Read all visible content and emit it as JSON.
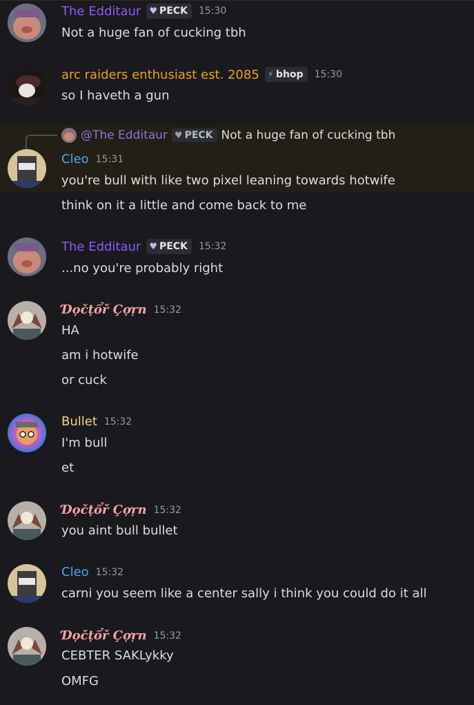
{
  "colors": {
    "edditaur": "#8a5cf5",
    "arc": "#f0a020",
    "cleo": "#4fa3f5",
    "bullet": "#f5d37a",
    "corn": "#f5a3a3"
  },
  "messages": [
    {
      "username": "The Edditaur",
      "tag": "PECK",
      "tag_icon": "heart-icon",
      "time": "15:30",
      "lines": [
        "Not a huge fan of cucking tbh"
      ]
    },
    {
      "username": "arc raiders enthusiast est. 2085",
      "tag": "bhop",
      "tag_icon": "lightning-icon",
      "time": "15:30",
      "lines": [
        "so I haveth a gun"
      ]
    },
    {
      "reply": {
        "username": "@The Edditaur",
        "tag": "PECK",
        "text": "Not a huge fan of cucking tbh"
      },
      "username": "Cleo",
      "time": "15:31",
      "lines": [
        "you're bull with like two pixel leaning towards hotwife",
        "think on it a little and come back to me"
      ]
    },
    {
      "username": "The Edditaur",
      "tag": "PECK",
      "tag_icon": "heart-icon",
      "time": "15:32",
      "lines": [
        "...no you're probably right"
      ]
    },
    {
      "username": "Ɗọčṭổř Çợṛn",
      "time": "15:32",
      "lines": [
        "HA",
        "am i hotwife",
        "or cuck"
      ]
    },
    {
      "username": "Bullet",
      "time": "15:32",
      "lines": [
        "I'm bull",
        "et"
      ]
    },
    {
      "username": "Ɗọčṭổř Çợṛn",
      "time": "15:32",
      "lines": [
        "you aint bull bullet"
      ]
    },
    {
      "username": "Cleo",
      "time": "15:32",
      "lines": [
        "carni you seem like a center sally i think you could do it all"
      ]
    },
    {
      "username": "Ɗọčṭổř Çợṛn",
      "time": "15:32",
      "lines": [
        "CEBTER SAKLykky",
        "OMFG"
      ]
    }
  ]
}
